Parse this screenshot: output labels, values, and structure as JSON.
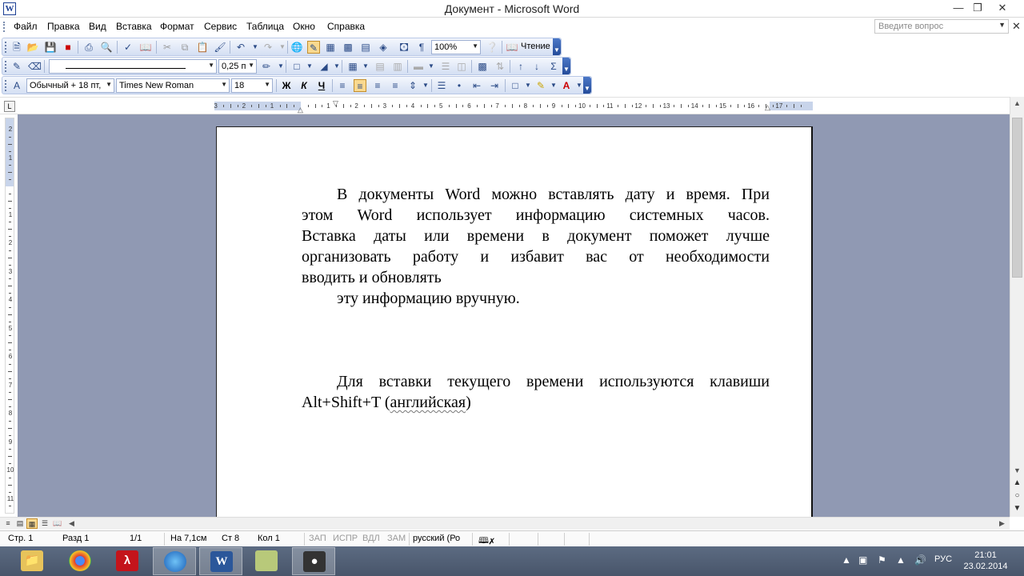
{
  "window": {
    "title": "Документ - Microsoft Word",
    "app_icon": "W",
    "minimize_icon": "minimize-icon",
    "restore_icon": "restore-icon",
    "close_icon": "close-icon"
  },
  "menu": {
    "items": [
      "Файл",
      "Правка",
      "Вид",
      "Вставка",
      "Формат",
      "Сервис",
      "Таблица",
      "Окно",
      "Справка"
    ],
    "help_placeholder": "Введите вопрос"
  },
  "toolbar_standard": {
    "zoom": "100%",
    "reading_label": "Чтение"
  },
  "toolbar_drawing": {
    "line_weight": "0,25 п"
  },
  "toolbar_formatting": {
    "style": "Обычный + 18 пт,",
    "font": "Times New Roman",
    "size": "18",
    "bold": "Ж",
    "italic": "К",
    "underline": "Ч",
    "align_center_active": true,
    "sum_icon": "Σ"
  },
  "ruler": {
    "numbers_left": [
      "3",
      "2",
      "1"
    ],
    "numbers_right": [
      "1",
      "2",
      "3",
      "4",
      "5",
      "6",
      "7",
      "8",
      "9",
      "10",
      "11",
      "12",
      "13",
      "14",
      "15",
      "16",
      "17"
    ],
    "vertical_numbers": [
      "2",
      "1",
      "1",
      "2",
      "3",
      "4",
      "5",
      "6",
      "7",
      "8",
      "9",
      "10",
      "11"
    ]
  },
  "document": {
    "para1_lines": [
      "В документы Word можно вставлять дату и время. При",
      "этом Word использует информацию системных часов.",
      "Вставка даты или времени в документ поможет лучше",
      "организовать работу и избавит вас от необходимости",
      "вводить и обновлять"
    ],
    "para2_line": "эту информацию вручную.",
    "para3_line1": "Для вставки текущего времени используются клавиши",
    "para3_line2_plain": "Alt+Shift+T (",
    "para3_line2_squiggle": "английская",
    "para3_line2_end": ")"
  },
  "status": {
    "page": "Стр. 1",
    "section": "Разд 1",
    "pages": "1/1",
    "at": "На 7,1см",
    "line": "Ст  8",
    "col": "Кол  1",
    "rec": "ЗАП",
    "trk": "ИСПР",
    "ext": "ВДЛ",
    "ovr": "ЗАМ",
    "language": "русский (Ро"
  },
  "taskbar": {
    "apps": [
      "explorer",
      "chrome",
      "acrobat",
      "globe",
      "word",
      "notepad",
      "media"
    ],
    "language": "РУС",
    "time": "21:01",
    "date": "23.02.2014"
  }
}
